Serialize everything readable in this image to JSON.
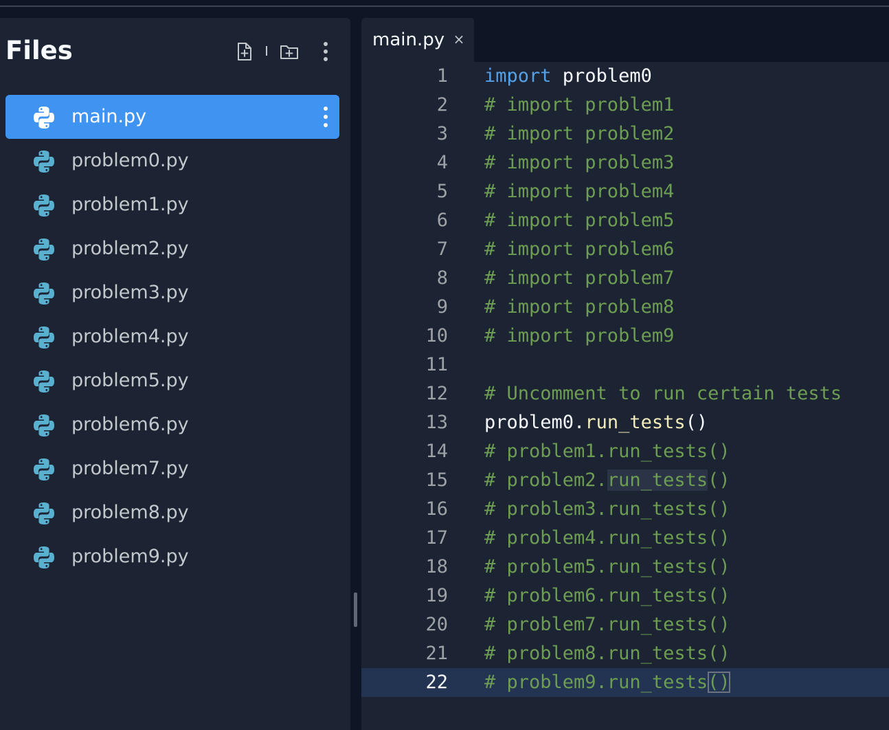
{
  "files_panel": {
    "title": "Files",
    "actions": {
      "new_file_icon": "file-plus-icon",
      "new_folder_icon": "folder-plus-icon",
      "more_icon": "kebab-menu-icon"
    },
    "files": [
      {
        "name": "main.py",
        "icon": "python-icon",
        "active": true
      },
      {
        "name": "problem0.py",
        "icon": "python-icon"
      },
      {
        "name": "problem1.py",
        "icon": "python-icon"
      },
      {
        "name": "problem2.py",
        "icon": "python-icon"
      },
      {
        "name": "problem3.py",
        "icon": "python-icon"
      },
      {
        "name": "problem4.py",
        "icon": "python-icon"
      },
      {
        "name": "problem5.py",
        "icon": "python-icon"
      },
      {
        "name": "problem6.py",
        "icon": "python-icon"
      },
      {
        "name": "problem7.py",
        "icon": "python-icon"
      },
      {
        "name": "problem8.py",
        "icon": "python-icon"
      },
      {
        "name": "problem9.py",
        "icon": "python-icon"
      }
    ]
  },
  "editor": {
    "tab": {
      "label": "main.py",
      "close": "×"
    },
    "current_line": 22,
    "lines": [
      {
        "num": "1",
        "tokens": [
          {
            "t": "import",
            "c": "kw"
          },
          {
            "t": " problem0",
            "c": "id"
          }
        ]
      },
      {
        "num": "2",
        "tokens": [
          {
            "t": "# import problem1",
            "c": "cm"
          }
        ]
      },
      {
        "num": "3",
        "tokens": [
          {
            "t": "# import problem2",
            "c": "cm"
          }
        ]
      },
      {
        "num": "4",
        "tokens": [
          {
            "t": "# import problem3",
            "c": "cm"
          }
        ]
      },
      {
        "num": "5",
        "tokens": [
          {
            "t": "# import problem4",
            "c": "cm"
          }
        ]
      },
      {
        "num": "6",
        "tokens": [
          {
            "t": "# import problem5",
            "c": "cm"
          }
        ]
      },
      {
        "num": "7",
        "tokens": [
          {
            "t": "# import problem6",
            "c": "cm"
          }
        ]
      },
      {
        "num": "8",
        "tokens": [
          {
            "t": "# import problem7",
            "c": "cm"
          }
        ]
      },
      {
        "num": "9",
        "tokens": [
          {
            "t": "# import problem8",
            "c": "cm"
          }
        ]
      },
      {
        "num": "10",
        "tokens": [
          {
            "t": "# import problem9",
            "c": "cm"
          }
        ]
      },
      {
        "num": "11",
        "tokens": []
      },
      {
        "num": "12",
        "tokens": [
          {
            "t": "# Uncomment to run certain tests",
            "c": "cm"
          }
        ]
      },
      {
        "num": "13",
        "tokens": [
          {
            "t": "problem0.",
            "c": "id"
          },
          {
            "t": "run_tests",
            "c": "fn"
          },
          {
            "t": "()",
            "c": "id"
          }
        ]
      },
      {
        "num": "14",
        "tokens": [
          {
            "t": "# problem1.run_tests()",
            "c": "cm"
          }
        ]
      },
      {
        "num": "15",
        "tokens": [
          {
            "t": "# problem2.",
            "c": "cm"
          },
          {
            "t": "run_tests",
            "c": "cm",
            "hl": true
          },
          {
            "t": "()",
            "c": "cm"
          }
        ]
      },
      {
        "num": "16",
        "tokens": [
          {
            "t": "# problem3.run_tests()",
            "c": "cm"
          }
        ]
      },
      {
        "num": "17",
        "tokens": [
          {
            "t": "# problem4.run_tests()",
            "c": "cm"
          }
        ]
      },
      {
        "num": "18",
        "tokens": [
          {
            "t": "# problem5.run_tests()",
            "c": "cm"
          }
        ]
      },
      {
        "num": "19",
        "tokens": [
          {
            "t": "# problem6.run_tests()",
            "c": "cm"
          }
        ]
      },
      {
        "num": "20",
        "tokens": [
          {
            "t": "# problem7.run_tests()",
            "c": "cm"
          }
        ]
      },
      {
        "num": "21",
        "tokens": [
          {
            "t": "# problem8.run_tests()",
            "c": "cm"
          }
        ]
      },
      {
        "num": "22",
        "tokens": [
          {
            "t": "# problem9.run_tests",
            "c": "cm"
          },
          {
            "t": "()",
            "c": "cm",
            "box": true
          }
        ]
      }
    ]
  },
  "colors": {
    "background": "#0e1525",
    "panel": "#1c2333",
    "selected_file": "#3f94f2",
    "keyword": "#56a0e6",
    "comment": "#6d9d52",
    "function": "#f2ecbc",
    "current_line": "#233453"
  }
}
